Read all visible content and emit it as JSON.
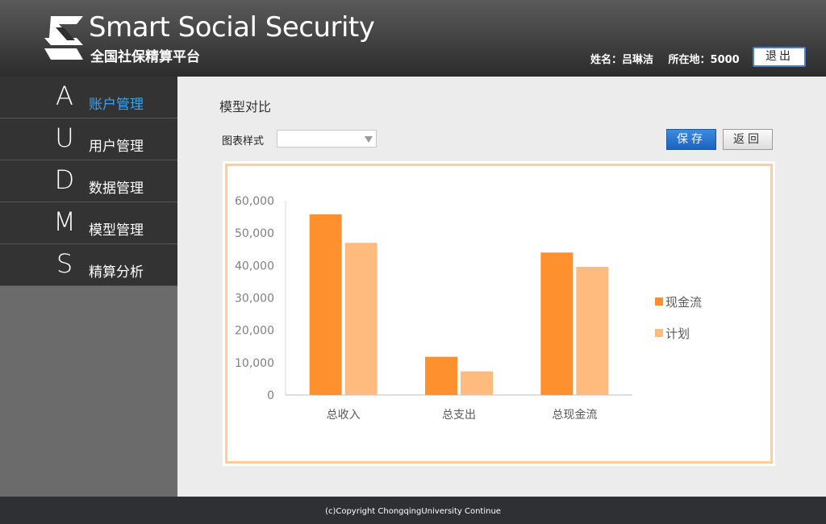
{
  "header": {
    "title": "Smart Social Security",
    "subtitle": "全国社保精算平台",
    "user_name": "姓名：吕琳洁",
    "location": "所在地：5000",
    "logout_label": "退出"
  },
  "sidebar": {
    "items": [
      {
        "letter": "A",
        "label": "账户管理",
        "active": true
      },
      {
        "letter": "U",
        "label": "用户管理",
        "active": false
      },
      {
        "letter": "D",
        "label": "数据管理",
        "active": false
      },
      {
        "letter": "M",
        "label": "模型管理",
        "active": false
      },
      {
        "letter": "S",
        "label": "精算分析",
        "active": false
      }
    ]
  },
  "main": {
    "page_title": "模型对比",
    "chart_style_label": "图表样式",
    "chart_style_value": "",
    "save_label": "保存",
    "back_label": "返回"
  },
  "chart_data": {
    "type": "bar",
    "categories": [
      "总收入",
      "总支出",
      "总现金流"
    ],
    "series": [
      {
        "name": "现金流",
        "values": [
          55800,
          11800,
          44000
        ],
        "color": "#ff902d"
      },
      {
        "name": "计划",
        "values": [
          47000,
          7300,
          39600
        ],
        "color": "#ffba7e"
      }
    ],
    "ylim": [
      0,
      60000
    ],
    "yticks": [
      "60,000",
      "50,000",
      "40,000",
      "30,000",
      "20,000",
      "10,000",
      "0"
    ],
    "legend": "right",
    "grid": false
  },
  "footer": {
    "copyright": "(c)Copyright ChongqingUniversity Continue"
  }
}
